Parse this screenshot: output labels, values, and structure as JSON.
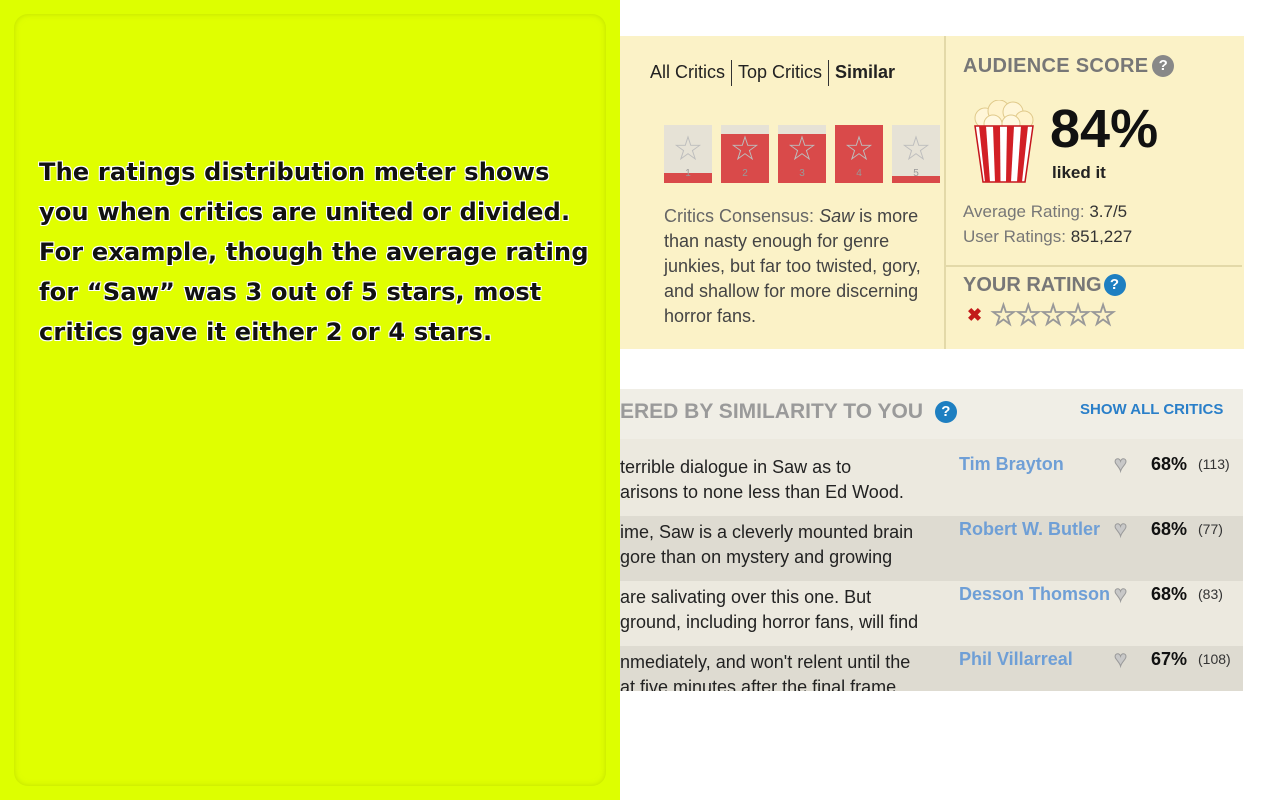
{
  "callout": {
    "text": "The ratings distribution meter shows you when critics are united or divided. For example, though the average rating for “Saw” was 3 out of 5 stars, most critics gave it either 2 or 4 stars."
  },
  "tabs": [
    {
      "label": "All Critics",
      "active": false
    },
    {
      "label": "Top Critics",
      "active": false
    },
    {
      "label": "Similar",
      "active": true
    }
  ],
  "meter": {
    "levels": [
      {
        "star": "1",
        "fill_fraction": 0.18
      },
      {
        "star": "2",
        "fill_fraction": 0.85
      },
      {
        "star": "3",
        "fill_fraction": 0.85
      },
      {
        "star": "4",
        "fill_fraction": 1.0
      },
      {
        "star": "5",
        "fill_fraction": 0.12
      }
    ],
    "fill_color": "#d94a4a"
  },
  "consensus": {
    "label": "Critics Consensus: ",
    "title": "Saw",
    "text": " is more than nasty enough for genre junkies, but far too twisted, gory, and shallow for more discerning horror fans."
  },
  "audience": {
    "title": "AUDIENCE SCORE",
    "help": "?",
    "score": "84%",
    "liked": "liked it",
    "avg_label": "Average Rating: ",
    "avg_value": "3.7/5",
    "users_label": "User Ratings: ",
    "users_value": "851,227"
  },
  "your_rating": {
    "title": "YOUR RATING",
    "help": "?",
    "clear": "✖",
    "stars": "☆☆☆☆☆"
  },
  "list": {
    "title": "ERED BY SIMILARITY TO YOU",
    "help": "?",
    "show_all": "SHOW ALL CRITICS",
    "rows": [
      {
        "line1": " terrible dialogue in Saw as to",
        "line2": "arisons to none less than Ed Wood.",
        "critic": "Tim Brayton",
        "pct": "68%",
        "count": "(113)"
      },
      {
        "line1": "ime, Saw is a cleverly mounted brain",
        "line2": " gore than on mystery and growing",
        "critic": "Robert W. Butler",
        "pct": "68%",
        "count": "(77)"
      },
      {
        "line1": "are salivating over this one. But",
        "line2": " ground, including horror fans, will find",
        "critic": "Desson Thomson",
        "pct": "68%",
        "count": "(83)"
      },
      {
        "line1": "nmediately, and won't relent until the",
        "line2": "at five minutes after the final frame.",
        "critic": "Phil Villarreal",
        "pct": "67%",
        "count": "(108)"
      }
    ],
    "row_colors": [
      "#ece9df",
      "#dedbd1"
    ],
    "link_color": "#6f9fd6"
  },
  "colors": {
    "callout": "#ddff00",
    "panel": "#fbf2c7",
    "accent_blue": "#2a7fc9"
  }
}
